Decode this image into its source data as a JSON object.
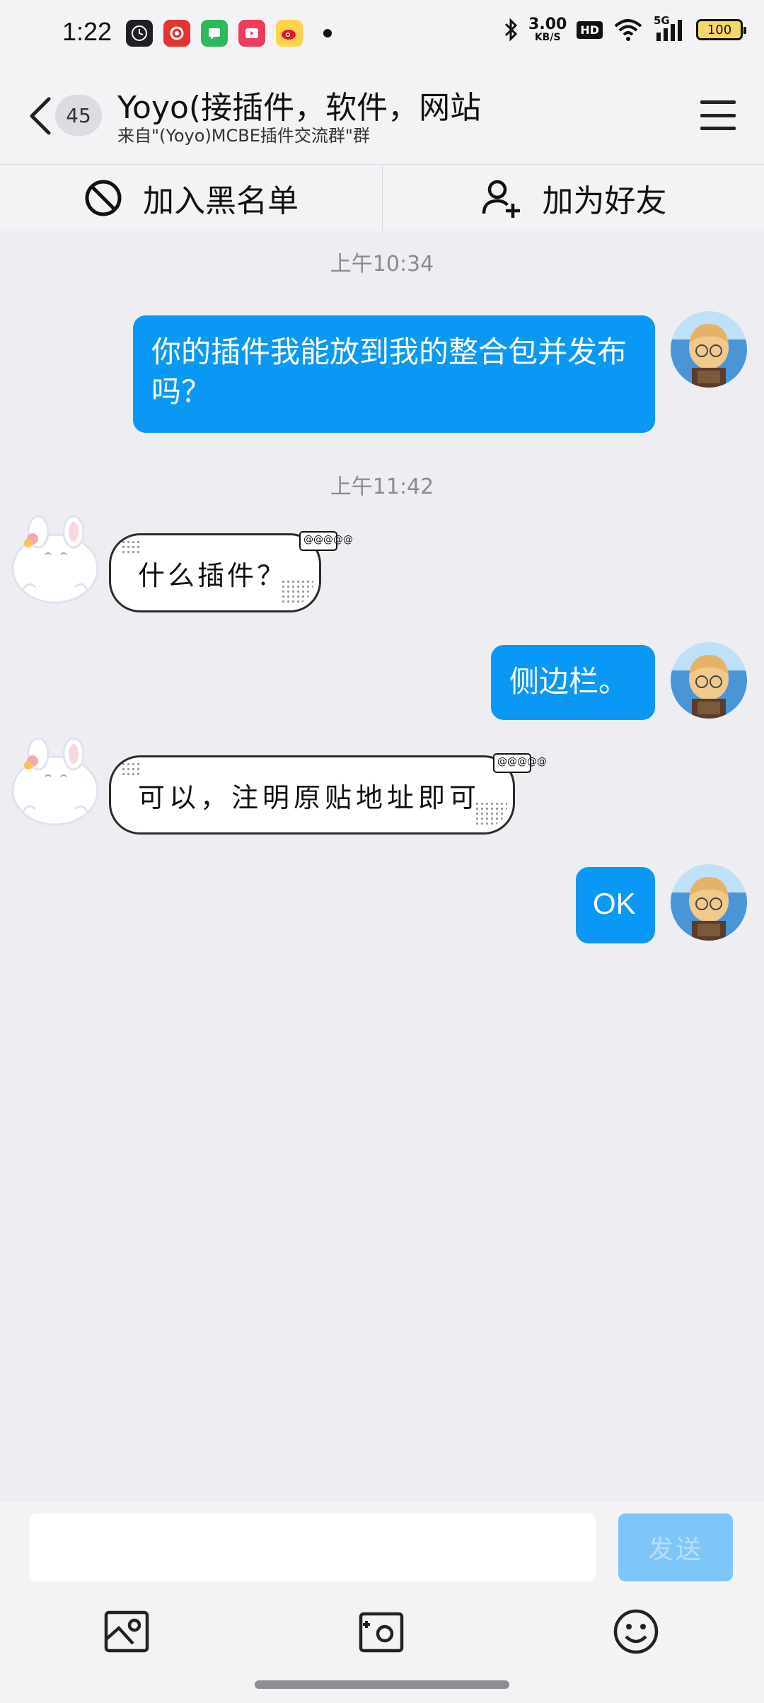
{
  "status_bar": {
    "time": "1:22",
    "net_speed_value": "3.00",
    "net_speed_unit": "KB/S",
    "hd_label": "HD",
    "network_label": "5G",
    "battery_level": "100"
  },
  "header": {
    "unread_count": "45",
    "title": "Yoyo(接插件，软件，网站",
    "subtitle": "来自\"(Yoyo)MCBE插件交流群\"群"
  },
  "actions": {
    "blacklist_label": "加入黑名单",
    "add_friend_label": "加为好友"
  },
  "messages": {
    "time_1": "上午10:34",
    "msg_1": "你的插件我能放到我的整合包并发布吗？",
    "time_2": "上午11:42",
    "msg_2": "什么插件？",
    "msg_3": "侧边栏。",
    "msg_4": "可以，注明原贴地址即可",
    "msg_5": "OK",
    "bubble_tag": "@@@@@"
  },
  "input": {
    "placeholder": "",
    "send_label": "发送"
  },
  "colors": {
    "accent": "#0a98f5",
    "send_disabled": "#7ec6f7",
    "background": "#ededf2"
  }
}
